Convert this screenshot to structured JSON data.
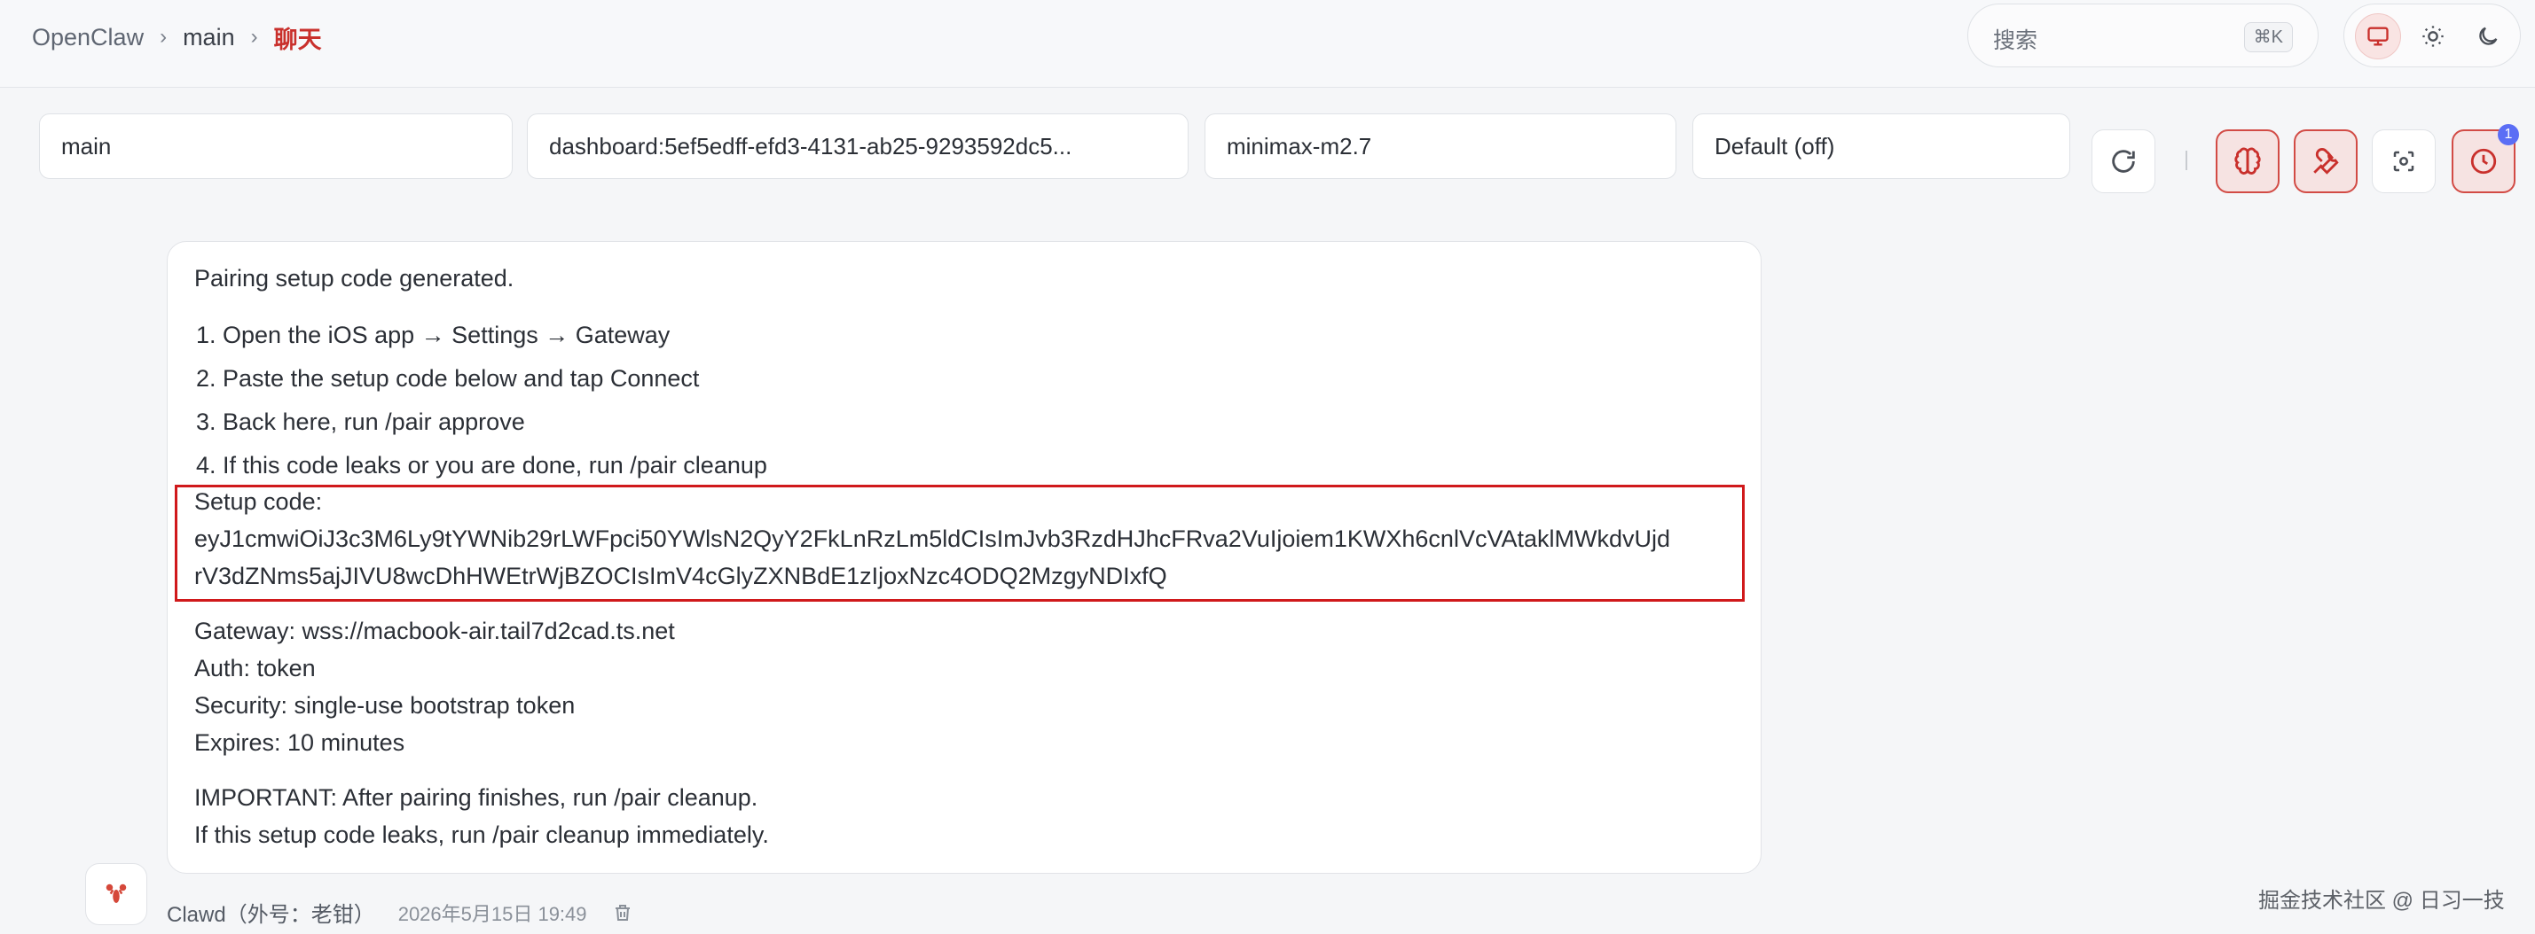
{
  "breadcrumb": {
    "root": "OpenClaw",
    "agent": "main",
    "current": "聊天",
    "separator": "›"
  },
  "search": {
    "label": "搜索",
    "shortcut": "⌘K"
  },
  "controls": {
    "agent": "main",
    "session": "dashboard:5ef5edff-efd3-4131-ab25-9293592dc5...",
    "model": "minimax-m2.7",
    "thinking": "Default (off)",
    "cron_badge": "1"
  },
  "message": {
    "intro": "Pairing setup code generated.",
    "steps": [
      "1. Open the iOS app → Settings → Gateway",
      "2. Paste the setup code below and tap Connect",
      "3. Back here, run /pair approve",
      "4. If this code leaks or you are done, run /pair cleanup"
    ],
    "setup_label": "Setup code:",
    "setup_code_line1": "eyJ1cmwiOiJ3c3M6Ly9tYWNib29rLWFpci50YWlsN2QyY2FkLnRzLm5ldCIsImJvb3RzdHJhcFRva2VuIjoiem1KWXh6cnlVcVAtaklMWkdvUjd",
    "setup_code_line2": "rV3dZNms5ajJIVU8wcDhHWEtrWjBZOCIsImV4cGlyZXNBdE1zIjoxNzc4ODQ2MzgyNDIxfQ",
    "gateway": "Gateway: wss://macbook-air.tail7d2cad.ts.net",
    "auth": "Auth: token",
    "security": "Security: single-use bootstrap token",
    "expires": "Expires: 10 minutes",
    "important": "IMPORTANT: After pairing finishes, run /pair cleanup.",
    "leak_note": "If this setup code leaks, run /pair cleanup immediately."
  },
  "footer": {
    "author": "Clawd（外号：老钳）",
    "timestamp": "2026年5月15日 19:49",
    "watermark": "掘金技术社区 @ 日习一技"
  },
  "colors": {
    "accent": "#c9302c",
    "highlight_box": "#d0191b",
    "badge": "#5b6ef5"
  }
}
